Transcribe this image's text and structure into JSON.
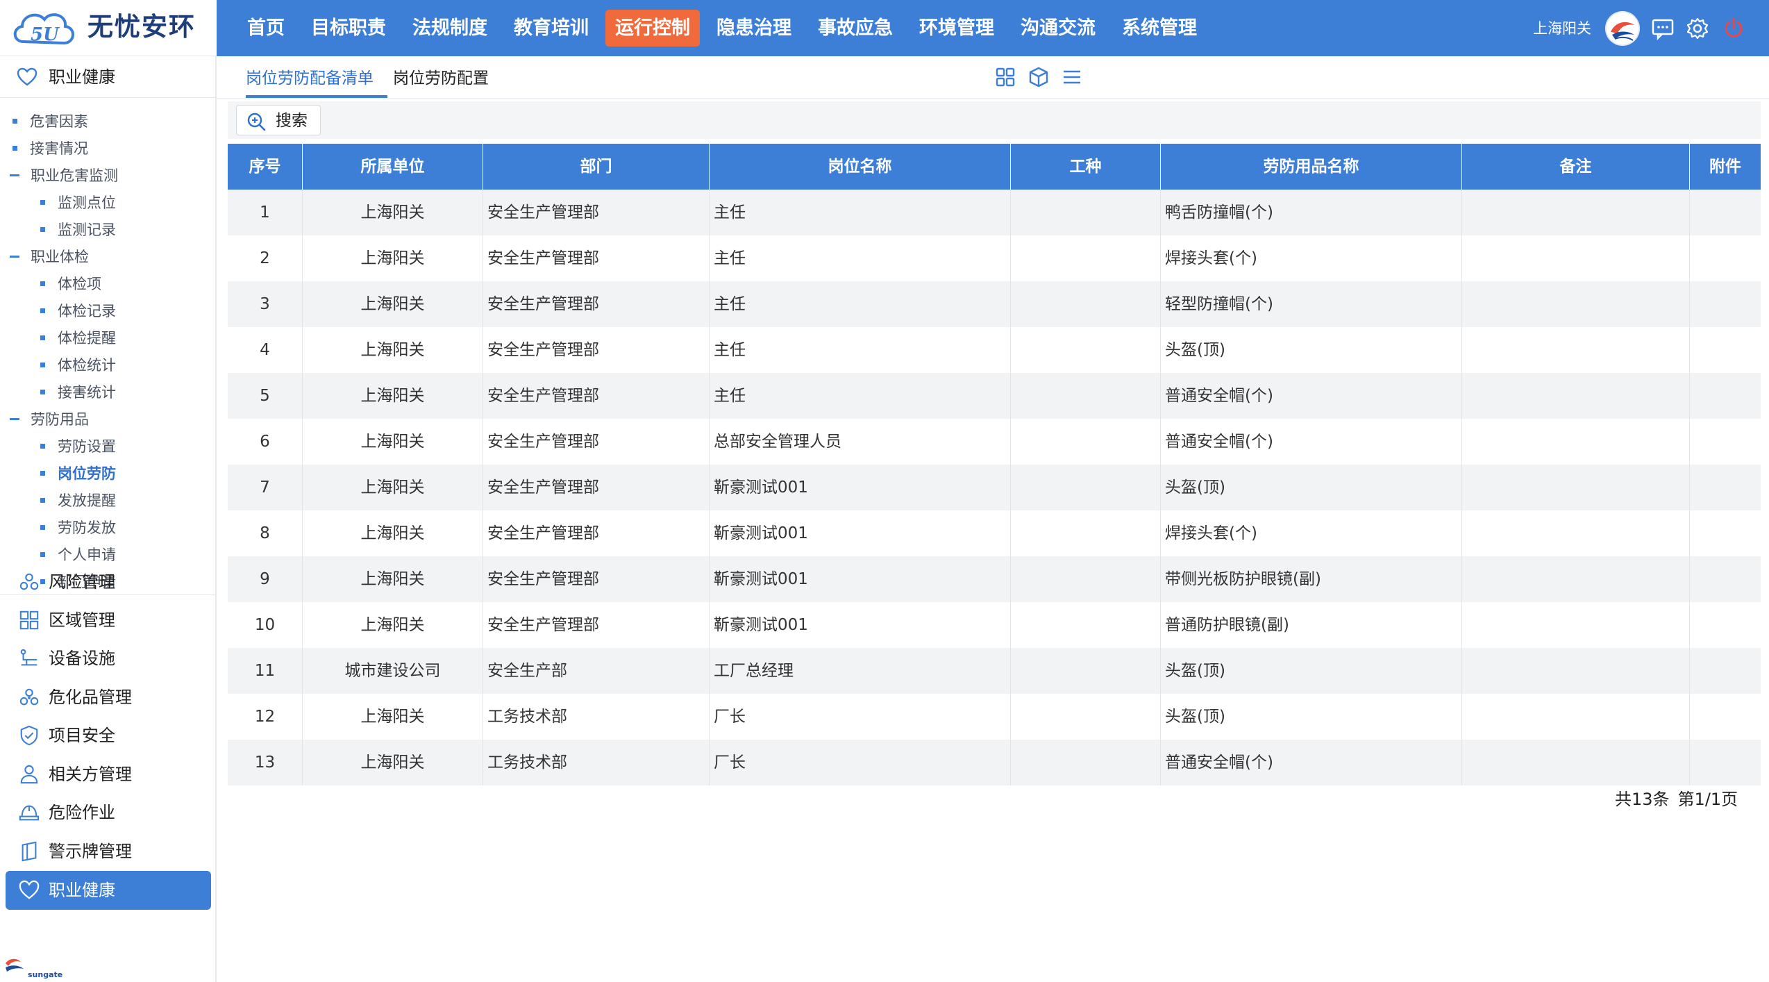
{
  "app": {
    "logo_text": "无忧安环",
    "logo_mark_text": "5U"
  },
  "nav": [
    {
      "label": "首页",
      "active": false
    },
    {
      "label": "目标职责",
      "active": false
    },
    {
      "label": "法规制度",
      "active": false
    },
    {
      "label": "教育培训",
      "active": false
    },
    {
      "label": "运行控制",
      "active": true
    },
    {
      "label": "隐患治理",
      "active": false
    },
    {
      "label": "事故应急",
      "active": false
    },
    {
      "label": "环境管理",
      "active": false
    },
    {
      "label": "沟通交流",
      "active": false
    },
    {
      "label": "系统管理",
      "active": false
    }
  ],
  "user": {
    "name": "上海阳关"
  },
  "sidebar": {
    "title": "职业健康",
    "tree": [
      {
        "label": "危害因素",
        "level": 1,
        "kind": "leaf"
      },
      {
        "label": "接害情况",
        "level": 1,
        "kind": "leaf"
      },
      {
        "label": "职业危害监测",
        "level": 1,
        "kind": "group"
      },
      {
        "label": "监测点位",
        "level": 2,
        "kind": "leaf"
      },
      {
        "label": "监测记录",
        "level": 2,
        "kind": "leaf"
      },
      {
        "label": "职业体检",
        "level": 1,
        "kind": "group"
      },
      {
        "label": "体检项",
        "level": 2,
        "kind": "leaf"
      },
      {
        "label": "体检记录",
        "level": 2,
        "kind": "leaf"
      },
      {
        "label": "体检提醒",
        "level": 2,
        "kind": "leaf"
      },
      {
        "label": "体检统计",
        "level": 2,
        "kind": "leaf"
      },
      {
        "label": "接害统计",
        "level": 2,
        "kind": "leaf"
      },
      {
        "label": "劳防用品",
        "level": 1,
        "kind": "group"
      },
      {
        "label": "劳防设置",
        "level": 2,
        "kind": "leaf"
      },
      {
        "label": "岗位劳防",
        "level": 2,
        "kind": "leaf",
        "active": true
      },
      {
        "label": "发放提醒",
        "level": 2,
        "kind": "leaf"
      },
      {
        "label": "劳防发放",
        "level": 2,
        "kind": "leaf"
      },
      {
        "label": "个人申请",
        "level": 2,
        "kind": "leaf"
      },
      {
        "label": "部门申请",
        "level": 2,
        "kind": "leaf"
      }
    ],
    "modules": [
      {
        "label": "风险管理",
        "icon": "risk-icon"
      },
      {
        "label": "区域管理",
        "icon": "grid-icon"
      },
      {
        "label": "设备设施",
        "icon": "equipment-icon"
      },
      {
        "label": "危化品管理",
        "icon": "hazard-icon"
      },
      {
        "label": "项目安全",
        "icon": "shield-icon"
      },
      {
        "label": "相关方管理",
        "icon": "person-icon"
      },
      {
        "label": "危险作业",
        "icon": "helmet-icon"
      },
      {
        "label": "警示牌管理",
        "icon": "sign-icon"
      },
      {
        "label": "职业健康",
        "icon": "heart-icon",
        "active": true
      }
    ],
    "footer_logo_text": "sungate"
  },
  "tabs": [
    {
      "label": "岗位劳防配备清单",
      "active": true
    },
    {
      "label": "岗位劳防配置",
      "active": false
    }
  ],
  "toolbar": {
    "search_label": "搜索"
  },
  "table": {
    "columns": [
      "序号",
      "所属单位",
      "部门",
      "岗位名称",
      "工种",
      "劳防用品名称",
      "备注",
      "附件"
    ],
    "rows": [
      [
        "1",
        "上海阳关",
        "安全生产管理部",
        "主任",
        "",
        "鸭舌防撞帽(个)",
        "",
        ""
      ],
      [
        "2",
        "上海阳关",
        "安全生产管理部",
        "主任",
        "",
        "焊接头套(个)",
        "",
        ""
      ],
      [
        "3",
        "上海阳关",
        "安全生产管理部",
        "主任",
        "",
        "轻型防撞帽(个)",
        "",
        ""
      ],
      [
        "4",
        "上海阳关",
        "安全生产管理部",
        "主任",
        "",
        "头盔(顶)",
        "",
        ""
      ],
      [
        "5",
        "上海阳关",
        "安全生产管理部",
        "主任",
        "",
        "普通安全帽(个)",
        "",
        ""
      ],
      [
        "6",
        "上海阳关",
        "安全生产管理部",
        "总部安全管理人员",
        "",
        "普通安全帽(个)",
        "",
        ""
      ],
      [
        "7",
        "上海阳关",
        "安全生产管理部",
        "靳豪测试001",
        "",
        "头盔(顶)",
        "",
        ""
      ],
      [
        "8",
        "上海阳关",
        "安全生产管理部",
        "靳豪测试001",
        "",
        "焊接头套(个)",
        "",
        ""
      ],
      [
        "9",
        "上海阳关",
        "安全生产管理部",
        "靳豪测试001",
        "",
        "带侧光板防护眼镜(副)",
        "",
        ""
      ],
      [
        "10",
        "上海阳关",
        "安全生产管理部",
        "靳豪测试001",
        "",
        "普通防护眼镜(副)",
        "",
        ""
      ],
      [
        "11",
        "城市建设公司",
        "安全生产部",
        "工厂总经理",
        "",
        "头盔(顶)",
        "",
        ""
      ],
      [
        "12",
        "上海阳关",
        "工务技术部",
        "厂长",
        "",
        "头盔(顶)",
        "",
        ""
      ],
      [
        "13",
        "上海阳关",
        "工务技术部",
        "厂长",
        "",
        "普通安全帽(个)",
        "",
        ""
      ]
    ]
  },
  "pager": {
    "total": "共13条",
    "page": "第1/1页"
  },
  "colors": {
    "primary": "#3d7fd6",
    "active_nav": "#f06a3c",
    "power": "#e5494b"
  }
}
